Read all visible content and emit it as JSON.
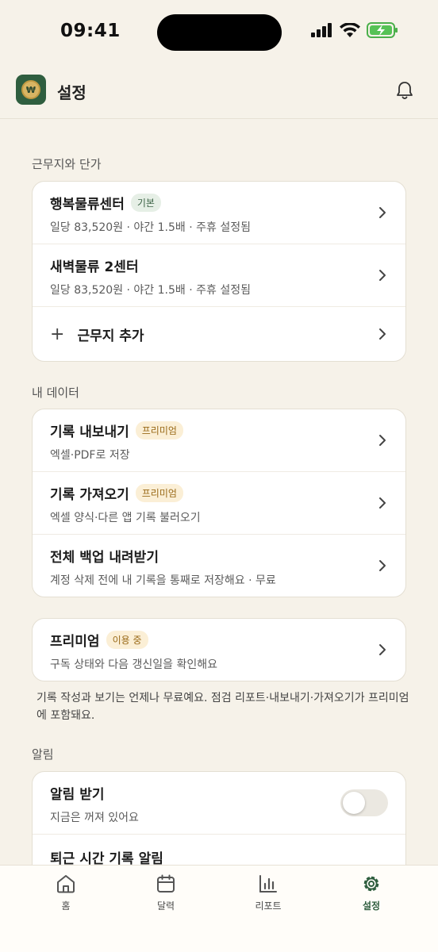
{
  "status": {
    "time": "09:41"
  },
  "header": {
    "title": "설정",
    "logo_letter": "₩"
  },
  "sections": {
    "workplaces": {
      "title": "근무지와 단가",
      "items": [
        {
          "title": "행복물류센터",
          "badge": "기본",
          "sub": "일당 83,520원 · 야간 1.5배 · 주휴 설정됨"
        },
        {
          "title": "새벽물류 2센터",
          "sub": "일당 83,520원 · 야간 1.5배 · 주휴 설정됨"
        }
      ],
      "add_label": "근무지 추가",
      "add_symbol": "+"
    },
    "data": {
      "title": "내 데이터",
      "items": [
        {
          "title": "기록 내보내기",
          "badge": "프리미엄",
          "sub": "엑셀·PDF로 저장"
        },
        {
          "title": "기록 가져오기",
          "badge": "프리미엄",
          "sub": "엑셀 양식·다른 앱 기록 불러오기"
        },
        {
          "title": "전체 백업 내려받기",
          "sub": "계정 삭제 전에 내 기록을 통째로 저장해요 · 무료"
        }
      ]
    },
    "premium": {
      "title": "프리미엄",
      "badge": "이용 중",
      "sub": "구독 상태와 다음 갱신일을 확인해요",
      "note": "기록 작성과 보기는 언제나 무료예요. 점검 리포트·내보내기·가져오기가 프리미엄에 포함돼요."
    },
    "notifications": {
      "title": "알림",
      "items": [
        {
          "title": "알림 받기",
          "sub": "지금은 꺼져 있어요",
          "enabled": false
        },
        {
          "title": "퇴근 시간 기록 알림"
        }
      ]
    }
  },
  "tabs": [
    {
      "label": "홈",
      "icon": "home-icon"
    },
    {
      "label": "달력",
      "icon": "calendar-icon"
    },
    {
      "label": "리포트",
      "icon": "bar-chart-icon"
    },
    {
      "label": "설정",
      "icon": "gear-icon",
      "active": true
    }
  ],
  "colors": {
    "accent": "#2f5e3f",
    "background": "#f6f2e9",
    "premium": "#9a6a18"
  }
}
